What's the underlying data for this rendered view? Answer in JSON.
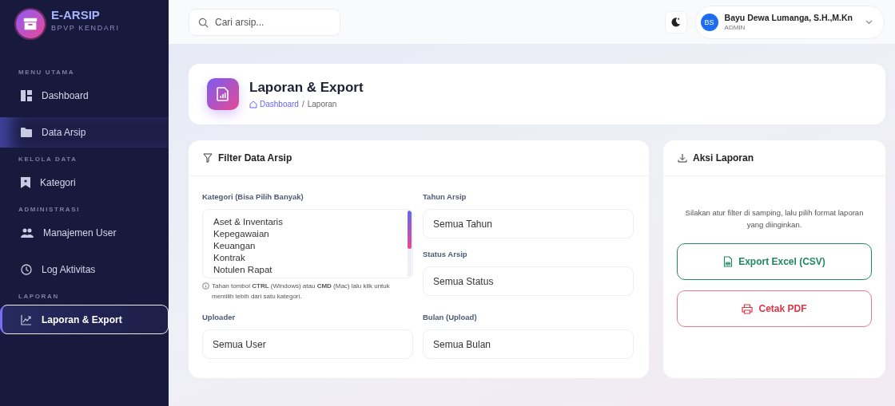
{
  "brand": {
    "title": "E-ARSIP",
    "subtitle": "BPVP KENDARI"
  },
  "sidebar": {
    "sections": [
      {
        "heading": "MENU UTAMA",
        "items": [
          {
            "label": "Dashboard",
            "kind": "dashboard",
            "selected": false,
            "hovered": false
          },
          {
            "label": "Data Arsip",
            "kind": "folder",
            "selected": false,
            "hovered": true
          }
        ]
      },
      {
        "heading": "KELOLA DATA",
        "items": [
          {
            "label": "Kategori",
            "kind": "bookmark",
            "selected": false,
            "hovered": false
          }
        ]
      },
      {
        "heading": "ADMINISTRASI",
        "items": [
          {
            "label": "Manajemen User",
            "kind": "users",
            "selected": false,
            "hovered": false
          },
          {
            "label": "Log Aktivitas",
            "kind": "clock",
            "selected": false,
            "hovered": false
          }
        ]
      },
      {
        "heading": "LAPORAN",
        "items": [
          {
            "label": "Laporan & Export",
            "kind": "chart",
            "selected": true,
            "hovered": false
          }
        ]
      }
    ]
  },
  "topbar": {
    "search": {
      "placeholder": "Cari arsip..."
    },
    "user": {
      "initials": "BS",
      "name": "Bayu Dewa Lumanga, S.H.,M.Kn",
      "role": "ADMIN"
    }
  },
  "page_header": {
    "title": "Laporan & Export",
    "breadcrumb": [
      "Dashboard",
      "/",
      "Laporan"
    ]
  },
  "filter": {
    "title": "Filter Data Arsip",
    "kategori": {
      "label": "Kategori (Bisa Pilih Banyak)",
      "options": [
        "Aset & Inventaris",
        "Kepegawaian",
        "Keuangan",
        "Kontrak",
        "Notulen Rapat"
      ],
      "hint": "Tahan tombol **CTRL** (Windows) atau **CMD** (Mac) lalu klik untuk memilih lebih dari satu kategori."
    },
    "tahun": {
      "label": "Tahun Arsip",
      "value": "Semua Tahun"
    },
    "status": {
      "label": "Status Arsip",
      "value": "Semua Status"
    },
    "uploader": {
      "label": "Uploader",
      "value": "Semua User"
    },
    "bulan": {
      "label": "Bulan (Upload)",
      "value": "Semua Bulan"
    }
  },
  "actions": {
    "title": "Aksi Laporan",
    "description": "Silakan atur filter di samping, lalu pilih format laporan yang diinginkan.",
    "buttons": [
      {
        "label": "Export Excel (CSV)",
        "kind": "excel"
      },
      {
        "label": "Cetak PDF",
        "kind": "pdf"
      }
    ]
  }
}
